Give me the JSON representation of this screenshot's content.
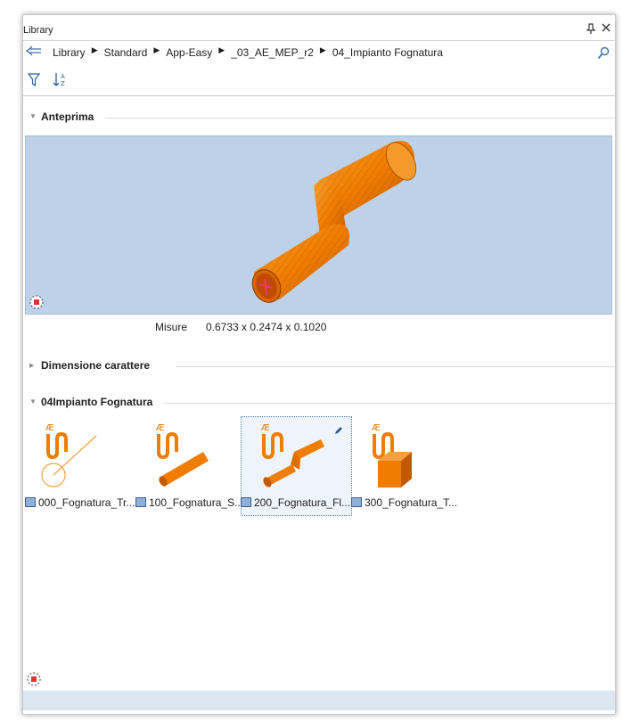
{
  "window": {
    "title": "Library",
    "pin_glyph": "↕",
    "close_glyph": "✕"
  },
  "breadcrumb": [
    "Library",
    "Standard",
    "App-Easy",
    "_03_AE_MEP_r2",
    "04_Impianto Fognatura"
  ],
  "toolbar": {
    "filter": "filter-icon",
    "sort": "sort-az-icon"
  },
  "sections": {
    "preview": {
      "title": "Anteprima",
      "expanded": true
    },
    "font_size": {
      "title": "Dimensione carattere",
      "expanded": false
    },
    "group": {
      "title": "04Impianto Fognatura",
      "expanded": true
    }
  },
  "preview": {
    "measure_label": "Misure",
    "measure_value": "0.6733 x 0.2474 x 0.1020",
    "bg_color": "#bdd2e8",
    "object_color": "#f07d00"
  },
  "items": [
    {
      "label": "000_Fognatura_Tr...",
      "selected": false
    },
    {
      "label": "100_Fognatura_S...",
      "selected": false
    },
    {
      "label": "200_Fognatura_Fl...",
      "selected": true
    },
    {
      "label": "300_Fognatura_T...",
      "selected": false
    }
  ]
}
